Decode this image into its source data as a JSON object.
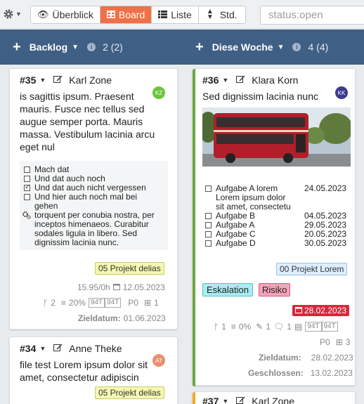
{
  "toolbar": {
    "tabs": [
      {
        "label": "Überblick",
        "icon": "eye-icon"
      },
      {
        "label": "Board",
        "icon": "board-icon"
      },
      {
        "label": "Liste",
        "icon": "list-icon"
      },
      {
        "label": "Std.",
        "icon": "sort-icon"
      }
    ],
    "search_value": "status:open"
  },
  "columns": [
    {
      "title": "Backlog",
      "count": "2 (2)"
    },
    {
      "title": "Diese Woche",
      "count": "4 (4)"
    }
  ],
  "cards": {
    "c35": {
      "number": "#35",
      "assignee": "Karl Zone",
      "avatar": "KZ",
      "desc": [
        "is sagittis ipsum. Praesent",
        "mauris. Fusce nec tellus sed",
        "augue semper porta. Mauris",
        "massa. Vestibulum lacinia arcu",
        "eget nul"
      ],
      "checklist": [
        {
          "text": "Mach dat",
          "checked": false
        },
        {
          "text": "Und dat auch noch",
          "checked": false
        },
        {
          "text": "Und dat auch nicht vergessen",
          "checked": true
        },
        {
          "text": "Und hier auch noch mal bei",
          "checked": false
        },
        {
          "text": "gehen",
          "checked": null
        }
      ],
      "note": [
        "torquent per conubia nostra, per",
        "inceptos himenaeos. Curabitur",
        "sodales ligula in libero. Sed",
        "dignissim lacinia nunc."
      ],
      "label": "05 Projekt delias",
      "hours": "15.95/0h",
      "date": "12.05.2023",
      "stats": {
        "branches": "2",
        "progress": "20%",
        "est1": "94T",
        "est2": "94T",
        "prio": "P0",
        "plus": "1"
      },
      "zieldatum_label": "Zieldatum:",
      "zieldatum": "01.06.2023"
    },
    "c34": {
      "number": "#34",
      "assignee": "Anne Theke",
      "avatar": "AT",
      "desc": [
        "file test Lorem ipsum dolor sit",
        "amet, consectetur adipiscin"
      ],
      "label": "05 Projekt delias"
    },
    "c36": {
      "number": "#36",
      "assignee": "Klara Korn",
      "avatar": "KK",
      "desc": [
        "Sed dignissim lacinia nunc"
      ],
      "tasks": [
        {
          "text": [
            "Aufgabe A lorem",
            "Lorem ipsum dolor",
            "sit amet, consectetu"
          ],
          "date": "24.05.2023"
        },
        {
          "text": [
            "Aufgabe B"
          ],
          "date": "04.05.2023"
        },
        {
          "text": [
            "Aufgabe A"
          ],
          "date": "29.05.2023"
        },
        {
          "text": [
            "Aufgabe C"
          ],
          "date": "20.05.2023"
        },
        {
          "text": [
            "Aufgabe D"
          ],
          "date": "30.05.2023"
        }
      ],
      "project": "00 Projekt Lorem",
      "tags": [
        "Eskalation",
        "Risiko"
      ],
      "due": "28.02.2023",
      "stats": {
        "branches": "1",
        "progress": "0%",
        "attach": "1",
        "comments": "1",
        "est1": "94T",
        "est2": "94T",
        "prio": "P0",
        "plus": "3"
      },
      "zieldatum_label": "Zieldatum:",
      "zieldatum": "28.02.2023",
      "closed_label": "Geschlossen:",
      "closed": "13.02.2023"
    },
    "c37": {
      "number": "#37",
      "assignee": "Karl Zone"
    }
  },
  "colors": {
    "header": "#3f5f84",
    "active_tab": "#f07048",
    "avatar_kz": "#6cc43c",
    "avatar_kk": "#3b3a8c",
    "avatar_at": "#e8906e",
    "card36_bar": "#6aa63d",
    "card37_bar": "#f5a623"
  }
}
